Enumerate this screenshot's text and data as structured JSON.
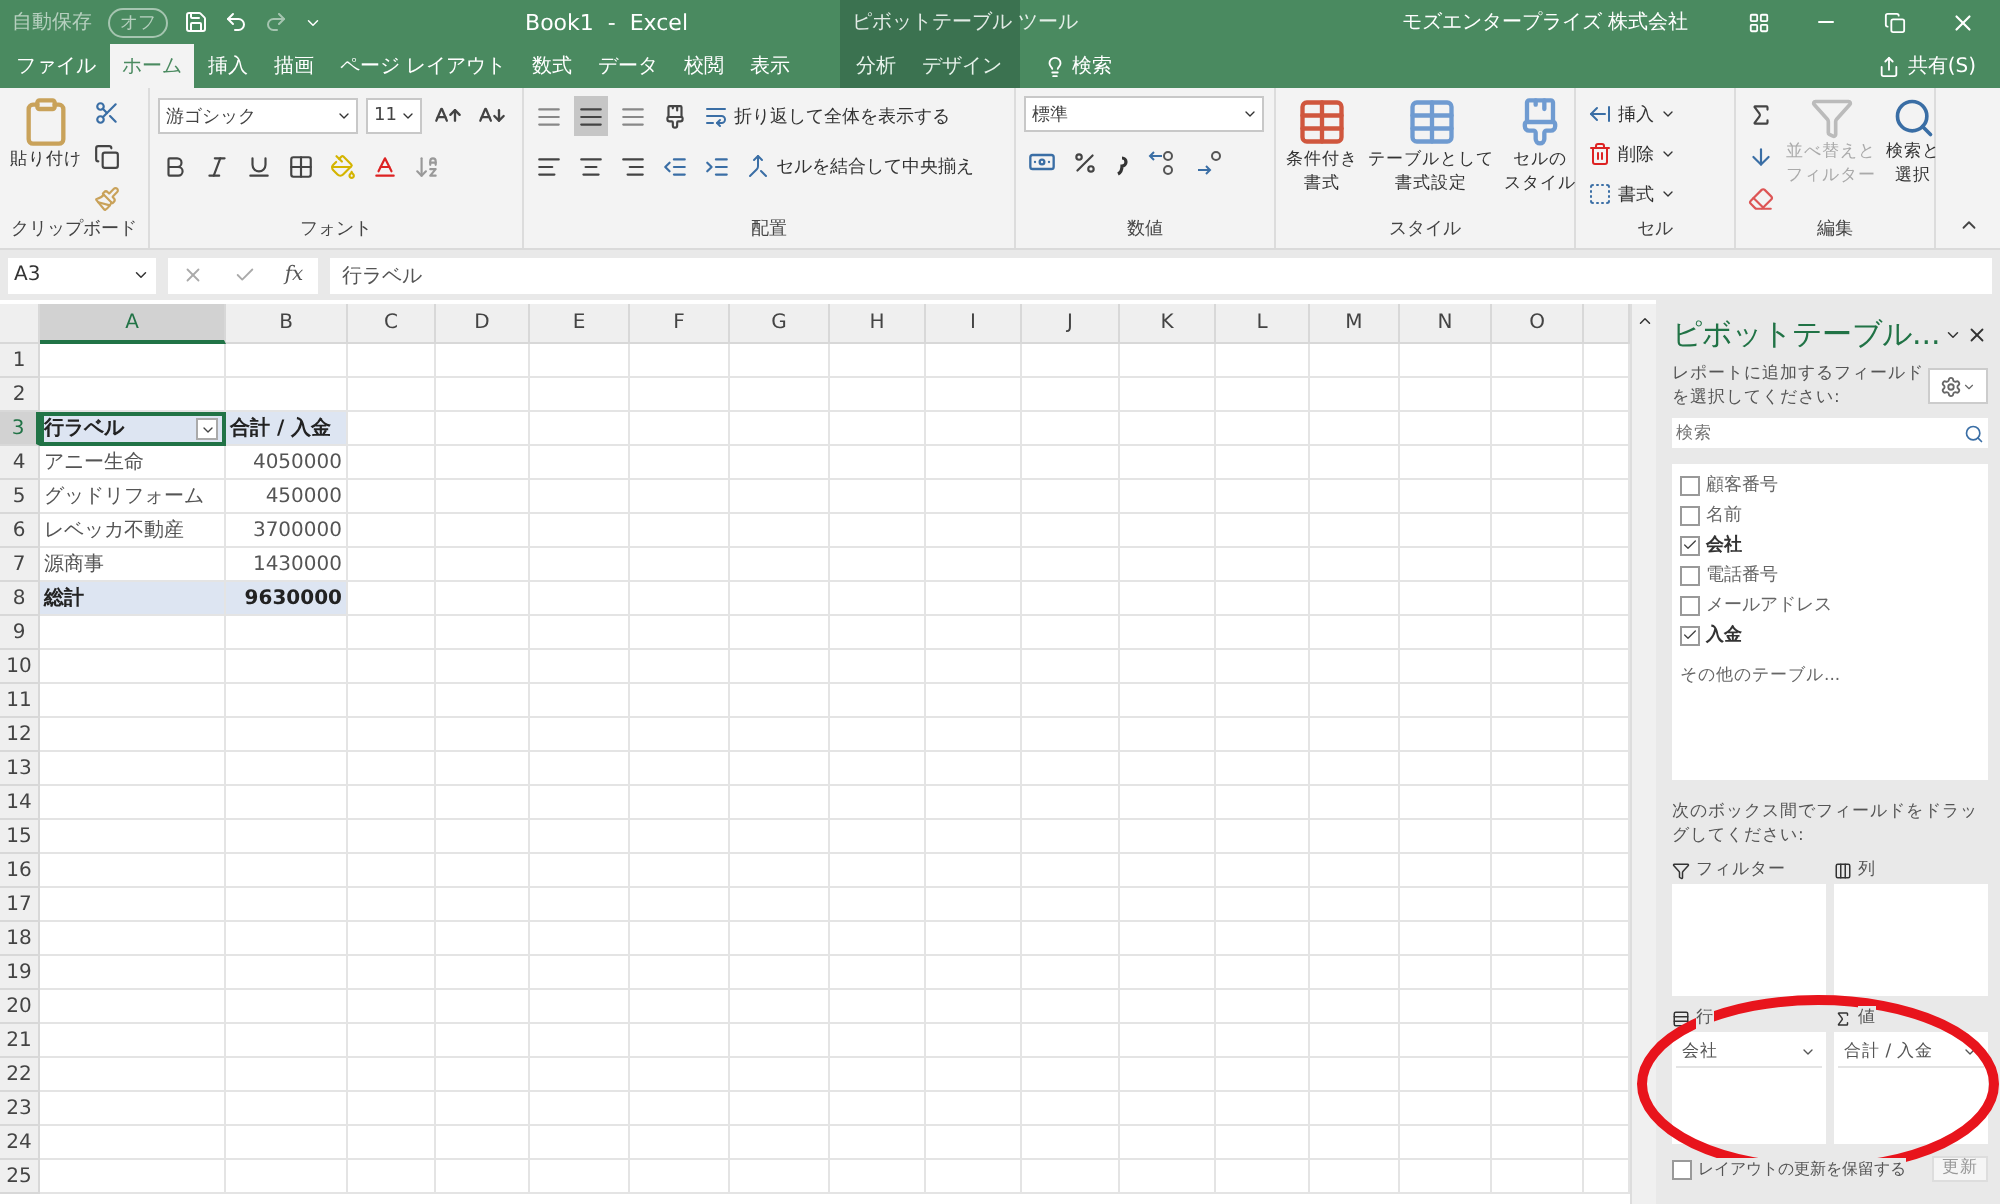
{
  "title_bar": {
    "autosave_label": "自動保存",
    "autosave_state": "オフ",
    "autosave_on": false,
    "title": "Book1  -  Excel",
    "context_title": "ピボットテーブル ツール",
    "account": "モズエンタープライズ 株式会社"
  },
  "tabs": [
    {
      "label": "ファイル",
      "selected": false,
      "contextual": false
    },
    {
      "label": "ホーム",
      "selected": true,
      "contextual": false
    },
    {
      "label": "挿入",
      "selected": false,
      "contextual": false
    },
    {
      "label": "描画",
      "selected": false,
      "contextual": false
    },
    {
      "label": "ページ レイアウト",
      "selected": false,
      "contextual": false
    },
    {
      "label": "数式",
      "selected": false,
      "contextual": false
    },
    {
      "label": "データ",
      "selected": false,
      "contextual": false
    },
    {
      "label": "校閲",
      "selected": false,
      "contextual": false
    },
    {
      "label": "表示",
      "selected": false,
      "contextual": false
    },
    {
      "label": "分析",
      "selected": false,
      "contextual": true
    },
    {
      "label": "デザイン",
      "selected": false,
      "contextual": true
    }
  ],
  "tell_me": "検索",
  "share": "共有(S)",
  "ribbon": {
    "clipboard": {
      "paste": "貼り付け",
      "label": "クリップボード"
    },
    "font": {
      "name": "游ゴシック",
      "size": "11",
      "label": "フォント"
    },
    "alignment": {
      "wrap": "折り返して全体を表示する",
      "merge": "セルを結合して中央揃え",
      "middle_selected": true,
      "label": "配置"
    },
    "number": {
      "format": "標準",
      "label": "数値"
    },
    "styles": {
      "buttons": [
        {
          "lines": [
            "条件付き",
            "書式"
          ]
        },
        {
          "lines": [
            "テーブルとして",
            "書式設定"
          ]
        },
        {
          "lines": [
            "セルの",
            "スタイル"
          ]
        }
      ],
      "label": "スタイル"
    },
    "cells": {
      "buttons": [
        "挿入",
        "削除",
        "書式"
      ],
      "label": "セル"
    },
    "editing": {
      "sort": [
        "並べ替えと",
        "フィルター"
      ],
      "sort_disabled": true,
      "find": [
        "検索と",
        "選択"
      ],
      "label": "編集"
    }
  },
  "formula_bar": {
    "name_box": "A3",
    "function_label": "fx",
    "formula": "行ラベル"
  },
  "sheet": {
    "columns": [
      {
        "label": "A",
        "selected": true
      },
      {
        "label": "B",
        "selected": false
      },
      {
        "label": "C",
        "selected": false
      },
      {
        "label": "D",
        "selected": false
      },
      {
        "label": "E",
        "selected": false
      },
      {
        "label": "F",
        "selected": false
      },
      {
        "label": "G",
        "selected": false
      },
      {
        "label": "H",
        "selected": false
      },
      {
        "label": "I",
        "selected": false
      },
      {
        "label": "J",
        "selected": false
      },
      {
        "label": "K",
        "selected": false
      },
      {
        "label": "L",
        "selected": false
      },
      {
        "label": "M",
        "selected": false
      },
      {
        "label": "N",
        "selected": false
      },
      {
        "label": "O",
        "selected": false
      }
    ],
    "rows": [
      {
        "number": "1",
        "kind": "blank",
        "selected": false
      },
      {
        "number": "2",
        "kind": "blank",
        "selected": false
      },
      {
        "number": "3",
        "kind": "header",
        "selected": true,
        "cells": [
          {
            "text": "行ラベル",
            "selected": true
          },
          {
            "text": "合計 / 入金",
            "selected": false
          }
        ]
      },
      {
        "number": "4",
        "kind": "item",
        "selected": false,
        "cells": [
          {
            "text": "アニー生命",
            "selected": false
          },
          {
            "text": "4050000",
            "selected": false
          }
        ]
      },
      {
        "number": "5",
        "kind": "item",
        "selected": false,
        "cells": [
          {
            "text": "グッドリフォーム",
            "selected": false
          },
          {
            "text": "450000",
            "selected": false
          }
        ]
      },
      {
        "number": "6",
        "kind": "item",
        "selected": false,
        "cells": [
          {
            "text": "レベッカ不動産",
            "selected": false
          },
          {
            "text": "3700000",
            "selected": false
          }
        ]
      },
      {
        "number": "7",
        "kind": "item",
        "selected": false,
        "cells": [
          {
            "text": "源商事",
            "selected": false
          },
          {
            "text": "1430000",
            "selected": false
          }
        ]
      },
      {
        "number": "8",
        "kind": "total",
        "selected": false,
        "cells": [
          {
            "text": "総計",
            "selected": false
          },
          {
            "text": "9630000",
            "selected": false
          }
        ]
      },
      {
        "number": "9",
        "kind": "blank",
        "selected": false
      },
      {
        "number": "10",
        "kind": "blank",
        "selected": false
      },
      {
        "number": "11",
        "kind": "blank",
        "selected": false
      },
      {
        "number": "12",
        "kind": "blank",
        "selected": false
      },
      {
        "number": "13",
        "kind": "blank",
        "selected": false
      },
      {
        "number": "14",
        "kind": "blank",
        "selected": false
      },
      {
        "number": "15",
        "kind": "blank",
        "selected": false
      },
      {
        "number": "16",
        "kind": "blank",
        "selected": false
      },
      {
        "number": "17",
        "kind": "blank",
        "selected": false
      },
      {
        "number": "18",
        "kind": "blank",
        "selected": false
      },
      {
        "number": "19",
        "kind": "blank",
        "selected": false
      },
      {
        "number": "20",
        "kind": "blank",
        "selected": false
      },
      {
        "number": "21",
        "kind": "blank",
        "selected": false
      },
      {
        "number": "22",
        "kind": "blank",
        "selected": false
      },
      {
        "number": "23",
        "kind": "blank",
        "selected": false
      },
      {
        "number": "24",
        "kind": "blank",
        "selected": false
      },
      {
        "number": "25",
        "kind": "blank",
        "selected": false
      }
    ]
  },
  "pivot_pane": {
    "title": "ピボットテーブル...",
    "instruction": "レポートに追加するフィールドを選択してください:",
    "search_placeholder": "検索",
    "fields": [
      {
        "label": "顧客番号",
        "checked": false
      },
      {
        "label": "名前",
        "checked": false
      },
      {
        "label": "会社",
        "checked": true
      },
      {
        "label": "電話番号",
        "checked": false
      },
      {
        "label": "メールアドレス",
        "checked": false
      },
      {
        "label": "入金",
        "checked": true
      }
    ],
    "more_tables": "その他のテーブル...",
    "drag_hint": "次のボックス間でフィールドをドラッグしてください:",
    "areas": [
      {
        "kind": "filter",
        "label": "フィルター"
      },
      {
        "kind": "columns",
        "label": "列"
      },
      {
        "kind": "rows",
        "label": "行",
        "items": [
          "会社"
        ]
      },
      {
        "kind": "values",
        "label": "値",
        "items": [
          "合計 / 入金"
        ]
      }
    ],
    "defer": {
      "label": "レイアウトの更新を保留する",
      "checked": false
    },
    "update_button": {
      "label": "更新",
      "disabled": true
    }
  }
}
